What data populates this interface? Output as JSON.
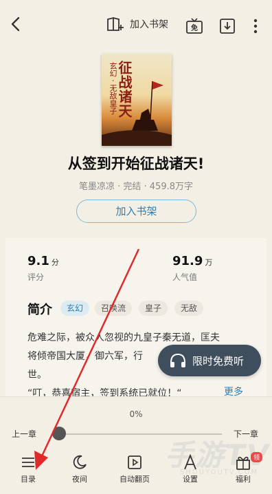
{
  "topbar": {
    "add_shelf_label": "加入书架",
    "free_badge": "免"
  },
  "book": {
    "cover_title": "征战诸天",
    "cover_subtitle": "玄幻 · 无敌皇子",
    "title": "从签到开始征战诸天!",
    "meta": "笔墨凉凉 · 完结 · 459.8万字",
    "add_button": "加入书架"
  },
  "stats": {
    "rating_value": "9.1",
    "rating_unit": "分",
    "rating_label": "评分",
    "popularity_value": "91.9",
    "popularity_unit": "万",
    "popularity_label": "人气值"
  },
  "intro": {
    "heading": "简介",
    "tags": [
      "玄幻",
      "召唤流",
      "皇子",
      "无敌"
    ],
    "lines": [
      "危难之际，被众人忽视的九皇子秦无道，匡夫",
      "将倾帝国大厦，御六军，行",
      "世。",
      "“叮，恭喜宿主，签到系统已就位！“"
    ],
    "more": "更多"
  },
  "audio_button": "限时免费听",
  "reader": {
    "progress": "0%",
    "progress_value": 0,
    "prev_chapter": "上一章",
    "next_chapter": "下一章"
  },
  "menu": [
    {
      "label": "目录",
      "icon": "list-icon"
    },
    {
      "label": "夜间",
      "icon": "moon-icon"
    },
    {
      "label": "自动翻页",
      "icon": "play-page-icon"
    },
    {
      "label": "设置",
      "icon": "font-icon"
    },
    {
      "label": "福利",
      "icon": "gift-icon"
    }
  ],
  "watermark": {
    "main": "手游TV",
    "sub": "SHOUYOUTV.COM",
    "badge": "领"
  },
  "colors": {
    "accent": "#2b7fb3",
    "background": "#f3efe4",
    "audio": "#3f4e5c",
    "arrow": "#e02a2a"
  }
}
